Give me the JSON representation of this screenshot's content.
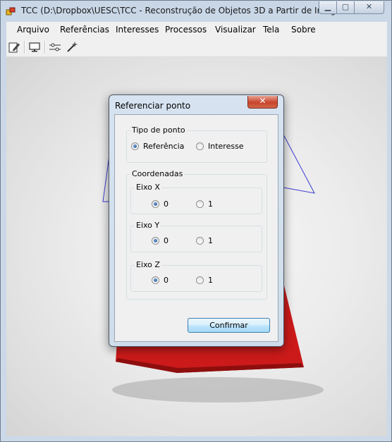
{
  "window": {
    "title": "TCC (D:\\Dropbox\\UESC\\TCC - Reconstrução de Objetos 3D a Partir de Image...",
    "caption_minimize": "▁",
    "caption_maximize": "▢",
    "caption_close": "✕"
  },
  "menu": {
    "items": [
      "Arquivo",
      "Referências",
      "Interesses",
      "Processos",
      "Visualizar",
      "Tela",
      "Sobre"
    ]
  },
  "toolbar": {
    "icons": [
      "edit-icon",
      "monitor-icon",
      "connect-icon",
      "magic-wand-icon"
    ]
  },
  "dialog": {
    "title": "Referenciar ponto",
    "close_glyph": "✕",
    "tipo_group": {
      "label": "Tipo de ponto",
      "options": [
        "Referência",
        "Interesse"
      ],
      "selected": "Referência"
    },
    "coord_group": {
      "label": "Coordenadas",
      "axes": [
        {
          "label": "Eixo X",
          "options": [
            "0",
            "1"
          ],
          "selected": "0"
        },
        {
          "label": "Eixo Y",
          "options": [
            "0",
            "1"
          ],
          "selected": "0"
        },
        {
          "label": "Eixo Z",
          "options": [
            "0",
            "1"
          ],
          "selected": "0"
        }
      ]
    },
    "confirm_label": "Confirmar"
  },
  "colors": {
    "model_red": "#cc1a1a",
    "model_edge": "#3a3ad0",
    "accent": "#3c7fb1"
  }
}
